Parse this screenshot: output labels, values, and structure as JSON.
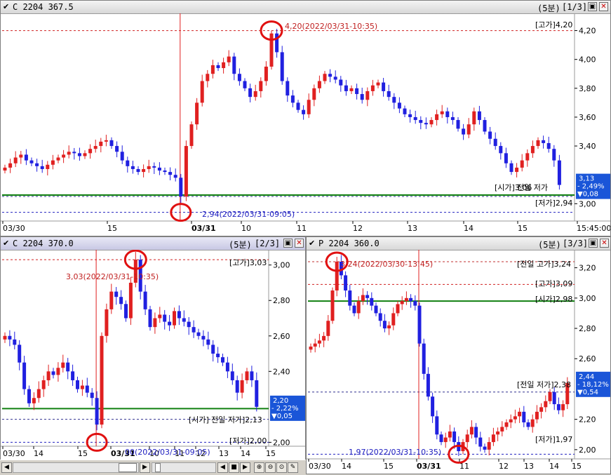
{
  "panels": [
    {
      "id": "p1",
      "header": {
        "title": "C 2204 367.5",
        "interval": "(5분)",
        "page": "[1/3]"
      },
      "yticks": [
        "4,20",
        "4,00",
        "3,80",
        "3,60",
        "3,40",
        "3,00"
      ],
      "xticks": [
        "03/30",
        "15",
        "03/31",
        "10",
        "11",
        "12",
        "13",
        "14",
        "15",
        "15:45:00"
      ],
      "labels": {
        "high_box": "[고가]4,20",
        "low_box": "[저가]2,94",
        "open_box": "[시가]3,06",
        "prevlow_box": "전일 저가",
        "high_note": "4,20(2022/03/31-10:35)",
        "low_note": "2,94(2022/03/31-09:05)"
      },
      "last": {
        "price": "3,13",
        "pct": "- 2,49%",
        "chg": "▼0,08"
      }
    },
    {
      "id": "p2",
      "header": {
        "title": "C 2204 370.0",
        "interval": "(5분)",
        "page": "[2/3]"
      },
      "yticks": [
        "3,00",
        "2,80",
        "2,60",
        "2,40",
        "2,00"
      ],
      "xticks": [
        "03/30",
        "14",
        "15",
        "03/31",
        "10",
        "11",
        "12",
        "13",
        "14",
        "15",
        "15:45:00"
      ],
      "labels": {
        "high_box": "[고가]3,03",
        "low_box": "[저가]2,00",
        "open_box": "[시가]",
        "prevlow_box": "전일 저가]2,13",
        "high_note": "3,03(2022/03/31-10:35)",
        "low_note": "00(2022/03/31-09:05)"
      },
      "last": {
        "price": "2,20",
        "pct": "- 2,22%",
        "chg": "▼0,05"
      }
    },
    {
      "id": "p3",
      "header": {
        "title": "P 2204 360.0",
        "interval": "(5분)",
        "page": "[3/3]"
      },
      "yticks": [
        "3,20",
        "3,00",
        "2,80",
        "2,60",
        "2,20",
        "2,00"
      ],
      "xticks": [
        "03/30",
        "14",
        "15",
        "03/31",
        "11",
        "12",
        "13",
        "14",
        "15",
        "15:45:00"
      ],
      "labels": {
        "prevhigh_box": "[전일 고가]3,24",
        "high_box": "[고가]3,09",
        "open_box": "[시가]2,98",
        "prevlow_box": "[전일 저가]2,38",
        "low_box": "[저가]1,97",
        "high_note": "3,24(2022/03/30-13:45)",
        "low_note": "1,97(2022/03/31-10:35)"
      },
      "last": {
        "price": "2,44",
        "pct": "- 18,12%",
        "chg": "▼0,54"
      }
    }
  ],
  "chart_data": [
    {
      "type": "candlestick",
      "title": "C 2204 367.5",
      "ylim": [
        2.88,
        4.3
      ],
      "up_color": "#e02020",
      "down_color": "#2020e0",
      "hlines": {
        "high": 4.2,
        "low": 2.94,
        "open": 3.06,
        "prev_low": 3.05
      },
      "close_path": [
        3.25,
        3.28,
        3.32,
        3.34,
        3.3,
        3.28,
        3.26,
        3.24,
        3.27,
        3.3,
        3.32,
        3.34,
        3.36,
        3.35,
        3.33,
        3.35,
        3.38,
        3.4,
        3.43,
        3.44,
        3.4,
        3.36,
        3.3,
        3.26,
        3.24,
        3.22,
        3.24,
        3.26,
        3.25,
        3.23,
        3.22,
        3.2,
        3.18,
        3.05,
        3.4,
        3.55,
        3.7,
        3.85,
        3.9,
        3.96,
        3.94,
        3.98,
        4.02,
        3.9,
        3.85,
        3.8,
        3.74,
        3.78,
        3.85,
        3.95,
        4.18,
        4.05,
        3.85,
        3.75,
        3.7,
        3.65,
        3.62,
        3.72,
        3.8,
        3.85,
        3.9,
        3.88,
        3.86,
        3.82,
        3.78,
        3.8,
        3.76,
        3.72,
        3.78,
        3.82,
        3.84,
        3.78,
        3.74,
        3.7,
        3.66,
        3.62,
        3.6,
        3.58,
        3.56,
        3.55,
        3.58,
        3.62,
        3.64,
        3.6,
        3.58,
        3.52,
        3.48,
        3.55,
        3.64,
        3.58,
        3.5,
        3.45,
        3.4,
        3.35,
        3.28,
        3.22,
        3.25,
        3.3,
        3.35,
        3.4,
        3.44,
        3.42,
        3.38,
        3.3,
        3.13
      ]
    },
    {
      "type": "candlestick",
      "title": "C 2204 370.0",
      "ylim": [
        1.97,
        3.07
      ],
      "up_color": "#e02020",
      "down_color": "#2020e0",
      "hlines": {
        "high": 3.03,
        "low": 2.0,
        "open": 2.19,
        "prev_low": 2.13
      },
      "close_path": [
        2.6,
        2.58,
        2.55,
        2.45,
        2.3,
        2.22,
        2.25,
        2.3,
        2.35,
        2.4,
        2.38,
        2.42,
        2.45,
        2.4,
        2.35,
        2.3,
        2.32,
        2.28,
        2.25,
        2.1,
        2.6,
        2.75,
        2.85,
        2.82,
        2.78,
        2.7,
        2.9,
        3.03,
        2.85,
        2.75,
        2.65,
        2.7,
        2.72,
        2.68,
        2.66,
        2.74,
        2.7,
        2.68,
        2.65,
        2.62,
        2.6,
        2.58,
        2.55,
        2.5,
        2.48,
        2.45,
        2.4,
        2.35,
        2.28,
        2.35,
        2.4,
        2.35,
        2.2
      ]
    },
    {
      "type": "candlestick",
      "title": "P 2204 360.0",
      "ylim": [
        1.93,
        3.3
      ],
      "up_color": "#e02020",
      "down_color": "#2020e0",
      "hlines": {
        "prev_high": 3.24,
        "high": 3.09,
        "open": 2.98,
        "prev_low": 2.38,
        "low": 1.97
      },
      "close_path": [
        2.68,
        2.7,
        2.72,
        2.75,
        2.85,
        3.05,
        3.24,
        3.15,
        3.05,
        2.95,
        2.9,
        2.98,
        3.02,
        3.0,
        2.95,
        2.9,
        2.85,
        2.8,
        2.82,
        2.9,
        2.96,
        2.98,
        3.0,
        2.98,
        2.95,
        2.7,
        2.5,
        2.35,
        2.22,
        2.1,
        2.05,
        2.08,
        2.12,
        2.05,
        1.99,
        2.05,
        2.1,
        2.15,
        2.08,
        2.02,
        2.0,
        2.05,
        2.1,
        2.12,
        2.15,
        2.18,
        2.2,
        2.22,
        2.25,
        2.18,
        2.15,
        2.2,
        2.25,
        2.28,
        2.32,
        2.38,
        2.3,
        2.26,
        2.3,
        2.44
      ]
    }
  ]
}
